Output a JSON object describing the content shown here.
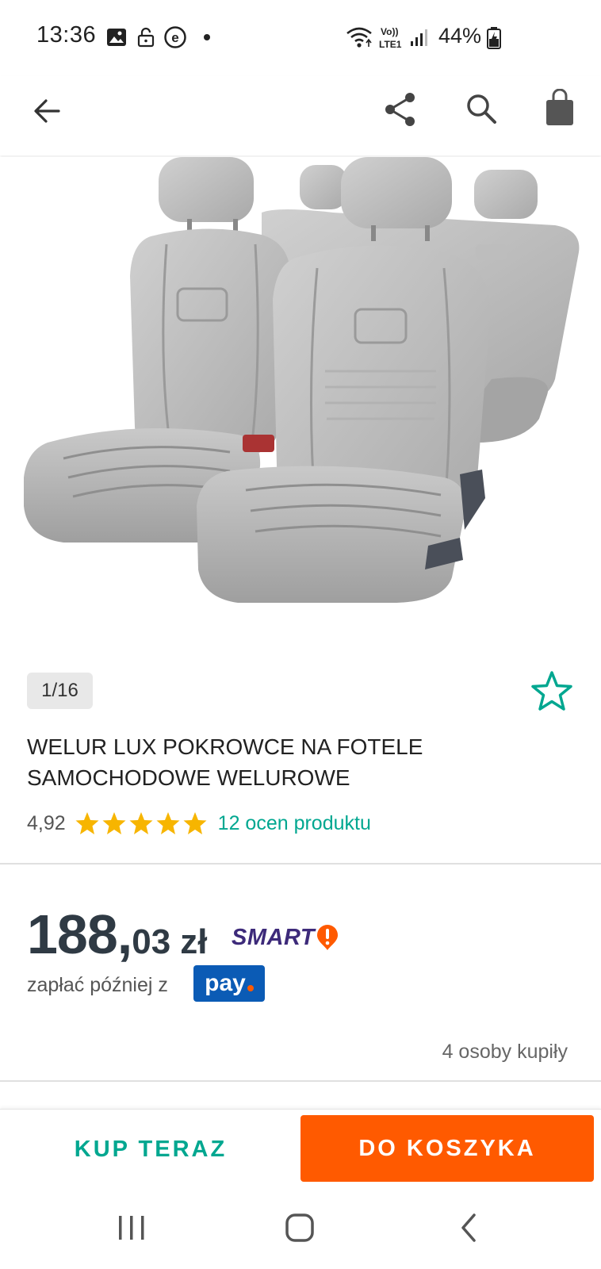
{
  "status_bar": {
    "time": "13:36",
    "battery": "44%",
    "icons": [
      "gallery-icon",
      "unlock-icon",
      "e-app-icon",
      "dot-icon",
      "wifi-icon",
      "volte-icon",
      "signal-icon",
      "battery-icon"
    ]
  },
  "app_bar": {
    "icons": [
      "back-arrow-icon",
      "share-icon",
      "search-icon",
      "cart-bag-icon"
    ]
  },
  "gallery": {
    "counter": "1/16"
  },
  "product": {
    "title_line1": "WELUR LUX POKROWCE NA FOTELE",
    "title_line2": "SAMOCHODOWE WELUROWE",
    "rating": "4,92",
    "stars": 5,
    "ratings_link": "12 ocen produktu",
    "price_int": "188,",
    "price_dec": "03",
    "price_currency": "zł",
    "smart_label": "SMART",
    "pay_later_text": "zapłać później z",
    "pay_badge": "pay",
    "buyers": "4 osoby kupiły"
  },
  "actions": {
    "buy_now": "KUP TERAZ",
    "add_to_cart": "DO KOSZYKA"
  },
  "colors": {
    "accent_teal": "#00a790",
    "cta_orange": "#ff5a00",
    "star_yellow": "#f7b500",
    "pay_blue": "#0b5bb5",
    "smart_purple": "#3d2a7a"
  }
}
